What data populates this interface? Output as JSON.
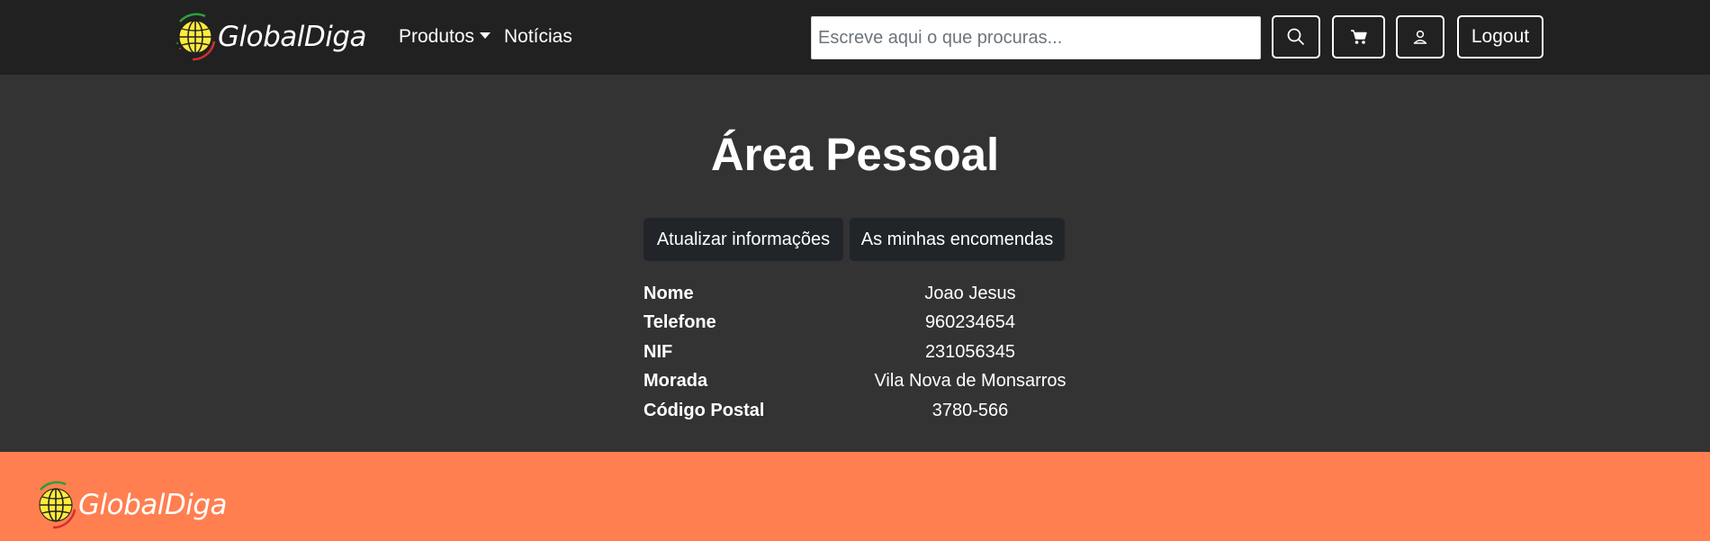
{
  "header": {
    "brand": "GlobalDiga",
    "nav": [
      {
        "label": "Produtos",
        "dropdown": true
      },
      {
        "label": "Notícias",
        "dropdown": false
      }
    ],
    "search": {
      "placeholder": "Escreve aqui o que procuras...",
      "value": ""
    },
    "icons": [
      "search-icon",
      "cart-icon",
      "user-icon"
    ],
    "logout_label": "Logout"
  },
  "main": {
    "title": "Área Pessoal",
    "tabs": [
      {
        "label": "Atualizar informações"
      },
      {
        "label": "As minhas encomendas"
      }
    ],
    "info": [
      {
        "label": "Nome",
        "value": "Joao Jesus"
      },
      {
        "label": "Telefone",
        "value": "960234654"
      },
      {
        "label": "NIF",
        "value": "231056345"
      },
      {
        "label": "Morada",
        "value": "Vila Nova de Monsarros"
      },
      {
        "label": "Código Postal",
        "value": "3780-566"
      }
    ]
  },
  "footer": {
    "brand": "GlobalDiga"
  },
  "colors": {
    "navbar": "#212121",
    "body": "#333333",
    "footer": "#ff7f50",
    "button": "#212529",
    "globe": "#ffeb3b"
  }
}
